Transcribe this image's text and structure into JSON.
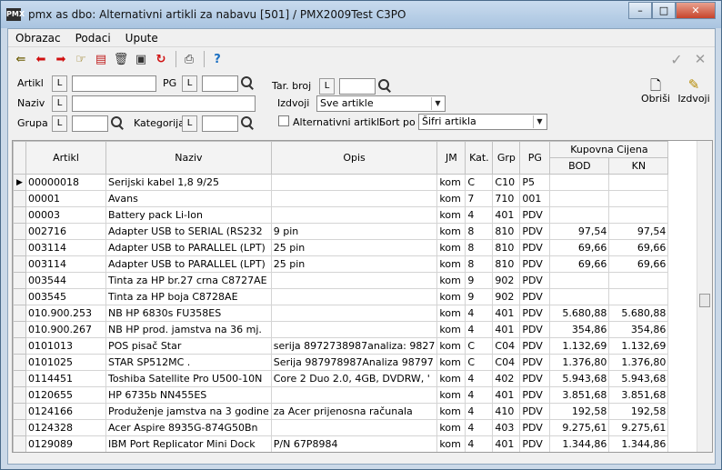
{
  "window": {
    "title": "pmx as dbo: Alternativni artikli za nabavu [501] / PMX2009Test C3PO",
    "app_icon": "PMX"
  },
  "winbtns": {
    "minimize": "–",
    "maximize": "□",
    "close": "✕"
  },
  "menu": [
    "Obrazac",
    "Podaci",
    "Upute"
  ],
  "toolbar": {
    "icons": [
      "exit-icon",
      "back-arrow-icon",
      "forward-arrow-icon",
      "open-icon",
      "new-record-icon",
      "delete-icon",
      "copy-icon",
      "refresh-icon",
      "print-icon",
      "help-icon"
    ],
    "glyphs": [
      "⇚",
      "⬅",
      "➡",
      "☞",
      "▤",
      "🗑",
      "▣",
      "↻",
      "⎙",
      "?"
    ],
    "confirm": "✓",
    "cancel": "✕"
  },
  "filters": {
    "artikl_label": "Artikl",
    "artikl_value": "",
    "pg_label": "PG",
    "pg_value": "",
    "naziv_label": "Naziv",
    "naziv_value": "",
    "grupa_label": "Grupa",
    "grupa_value": "",
    "kategorija_label": "Kategorija",
    "kategorija_value": "",
    "tarbroj_label": "Tar. broj",
    "tarbroj_value": "",
    "izdvoji_label": "Izdvoji",
    "izdvoji_value": "Sve artikle",
    "alternativni_label": "Alternativni artikli",
    "sortpo_label": "Sort po",
    "sortpo_value": "Šifri artikla",
    "l_button": "L",
    "obrisi_label": "Obriši",
    "izdvoji_button_label": "Izdvoji"
  },
  "grid": {
    "columns": [
      "Artikl",
      "Naziv",
      "Opis",
      "JM",
      "Kat.",
      "Grp",
      "PG"
    ],
    "group_header": "Kupovna Cijena",
    "sub_columns": [
      "BOD",
      "KN"
    ],
    "current_row_marker": "▶",
    "rows": [
      [
        "00000018",
        "Serijski kabel 1,8 9/25",
        "",
        "kom",
        "C",
        "C10",
        "P5",
        "",
        ""
      ],
      [
        "00001",
        "Avans",
        "",
        "kom",
        "7",
        "710",
        "001",
        "",
        ""
      ],
      [
        "00003",
        "Battery pack Li-Ion",
        "",
        "kom",
        "4",
        "401",
        "PDV",
        "",
        ""
      ],
      [
        "002716",
        "Adapter USB to SERIAL (RS232",
        "9 pin",
        "kom",
        "8",
        "810",
        "PDV",
        "97,54",
        "97,54"
      ],
      [
        "003114",
        "Adapter USB to PARALLEL (LPT)",
        "25 pin",
        "kom",
        "8",
        "810",
        "PDV",
        "69,66",
        "69,66"
      ],
      [
        "003114",
        "Adapter USB to PARALLEL (LPT)",
        "25 pin",
        "kom",
        "8",
        "810",
        "PDV",
        "69,66",
        "69,66"
      ],
      [
        "003544",
        "Tinta za HP br.27 crna C8727AE",
        "",
        "kom",
        "9",
        "902",
        "PDV",
        "",
        ""
      ],
      [
        "003545",
        "Tinta za HP boja C8728AE",
        "",
        "kom",
        "9",
        "902",
        "PDV",
        "",
        ""
      ],
      [
        "010.900.253",
        "NB HP 6830s FU358ES",
        "",
        "kom",
        "4",
        "401",
        "PDV",
        "5.680,88",
        "5.680,88"
      ],
      [
        "010.900.267",
        "NB HP prod. jamstva na 36 mj.",
        "",
        "kom",
        "4",
        "401",
        "PDV",
        "354,86",
        "354,86"
      ],
      [
        "0101013",
        "POS pisač Star",
        "serija 8972738987analiza: 9827",
        "kom",
        "C",
        "C04",
        "PDV",
        "1.132,69",
        "1.132,69"
      ],
      [
        "0101025",
        "STAR SP512MC .",
        "Serija  987978987Analiza 98797",
        "kom",
        "C",
        "C04",
        "PDV",
        "1.376,80",
        "1.376,80"
      ],
      [
        "0114451",
        "Toshiba Satellite Pro U500-10N",
        "Core 2 Duo 2.0, 4GB, DVDRW, '",
        "kom",
        "4",
        "402",
        "PDV",
        "5.943,68",
        "5.943,68"
      ],
      [
        "0120655",
        "HP 6735b NN455ES",
        "",
        "kom",
        "4",
        "401",
        "PDV",
        "3.851,68",
        "3.851,68"
      ],
      [
        "0124166",
        "Produženje jamstva na 3 godine",
        "za Acer prijenosna računala",
        "kom",
        "4",
        "410",
        "PDV",
        "192,58",
        "192,58"
      ],
      [
        "0124328",
        "Acer Aspire 8935G-874G50Bn",
        "",
        "kom",
        "4",
        "403",
        "PDV",
        "9.275,61",
        "9.275,61"
      ],
      [
        "0129089",
        "IBM Port Replicator Mini Dock",
        "P/N 67P8984",
        "kom",
        "4",
        "401",
        "PDV",
        "1.344,86",
        "1.344,86"
      ]
    ]
  }
}
